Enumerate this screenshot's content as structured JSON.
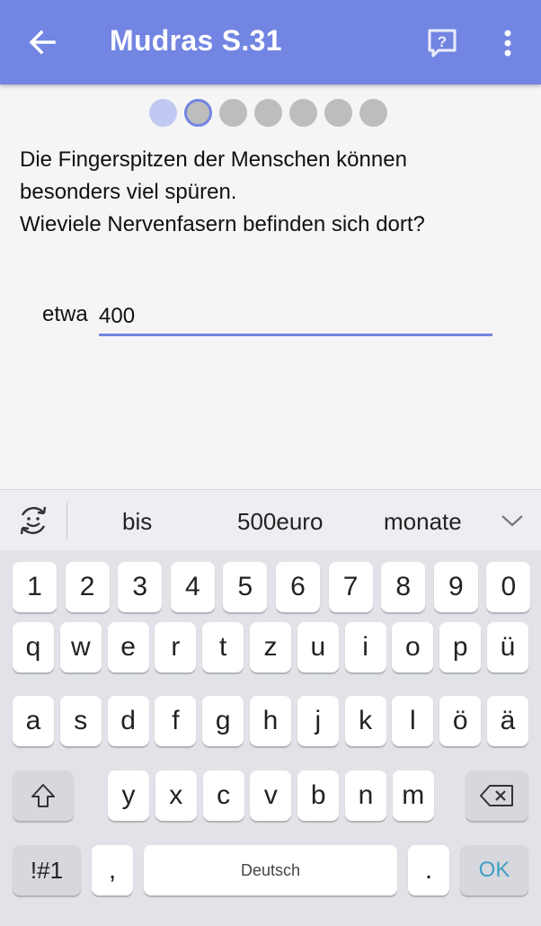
{
  "appbar": {
    "title": "Mudras S.31",
    "back_icon": "arrow-left-icon",
    "help_icon": "question-comment-icon",
    "more_icon": "more-vert-icon",
    "color": "#7385e2"
  },
  "progress": {
    "total_steps": 7,
    "current_step": 2,
    "colors": {
      "done": "#c1c8f2",
      "pending": "#bdbdbd",
      "current_ring": "#7385e2"
    }
  },
  "question": {
    "lines": [
      "Die Fingerspitzen der Menschen können",
      "besonders viel spüren.",
      "Wieviele Nervenfasern befinden sich dort?"
    ]
  },
  "answer": {
    "prefix": "etwa",
    "value": "400"
  },
  "keyboard": {
    "suggestions": [
      "bis",
      "500euro",
      "monate"
    ],
    "emoji_icon": "emoji-cycle-icon",
    "collapse_icon": "chevron-down-icon",
    "rows": [
      [
        "1",
        "2",
        "3",
        "4",
        "5",
        "6",
        "7",
        "8",
        "9",
        "0"
      ],
      [
        "q",
        "w",
        "e",
        "r",
        "t",
        "z",
        "u",
        "i",
        "o",
        "p",
        "ü"
      ],
      [
        "a",
        "s",
        "d",
        "f",
        "g",
        "h",
        "j",
        "k",
        "l",
        "ö",
        "ä"
      ],
      [
        "y",
        "x",
        "c",
        "v",
        "b",
        "n",
        "m"
      ]
    ],
    "shift_icon": "shift-arrow-icon",
    "backspace_icon": "backspace-icon",
    "symbols_label": "!#1",
    "comma_label": ",",
    "space_label": "Deutsch",
    "period_label": ".",
    "ok_label": "OK",
    "ok_color": "#3f9ec4"
  }
}
